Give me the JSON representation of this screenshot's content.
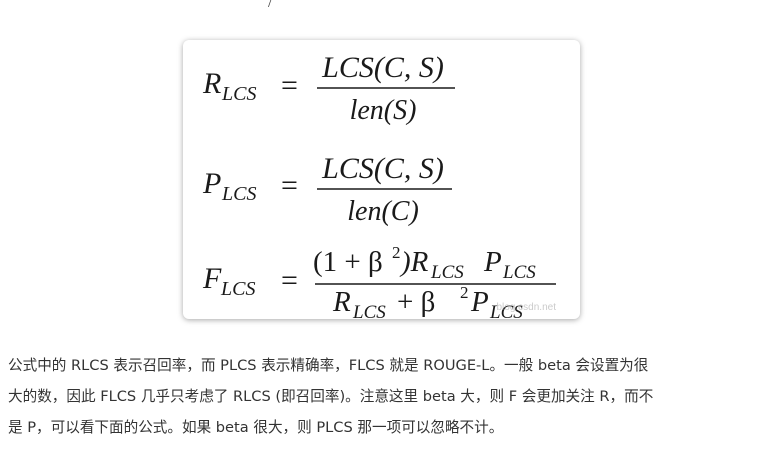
{
  "top_mark": "/",
  "formulas": {
    "r": {
      "lhs": "R",
      "lhs_sub": "LCS",
      "eq": "=",
      "num": "LCS(C, S)",
      "den": "len(S)"
    },
    "p": {
      "lhs": "P",
      "lhs_sub": "LCS",
      "eq": "=",
      "num": "LCS(C, S)",
      "den": "len(C)"
    },
    "f": {
      "lhs": "F",
      "lhs_sub": "LCS",
      "eq": "=",
      "num_a": "(1 + β",
      "num_a_sup": "2",
      "num_b": ")R",
      "num_b_sub": "LCS",
      "num_c": "P",
      "num_c_sub": "LCS",
      "den_a": "R",
      "den_a_sub": "LCS",
      "den_b": " + β",
      "den_b_sup": "2",
      "den_c": "P",
      "den_c_sub": "LCS"
    }
  },
  "watermark": "blog.csdn.net",
  "paragraph_lines": [
    "公式中的 RLCS 表示召回率，而 PLCS 表示精确率，FLCS 就是 ROUGE-L。一般 beta 会设置为很",
    "大的数，因此 FLCS 几乎只考虑了 RLCS (即召回率)。注意这里 beta 大，则 F 会更加关注 R，而不",
    "是 P，可以看下面的公式。如果 beta 很大，则 PLCS 那一项可以忽略不计。"
  ]
}
